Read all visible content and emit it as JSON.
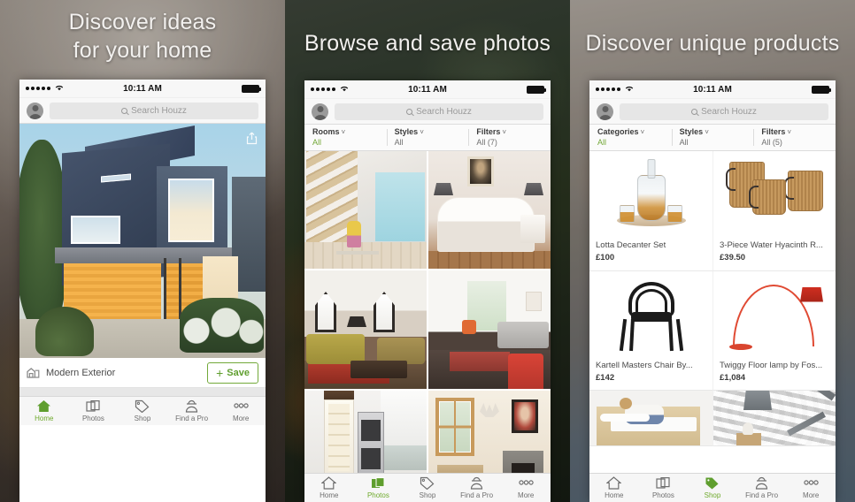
{
  "panels": [
    {
      "headline_line1": "Discover ideas",
      "headline_line2": "for your home",
      "status": {
        "time": "10:11 AM"
      },
      "search": {
        "placeholder": "Search Houzz"
      },
      "photo_caption": "Modern Exterior",
      "save_button": "Save",
      "save_plus": "+",
      "tabs": [
        {
          "label": "Home",
          "icon": "home-icon",
          "active": true
        },
        {
          "label": "Photos",
          "icon": "photos-icon",
          "active": false
        },
        {
          "label": "Shop",
          "icon": "tag-icon",
          "active": false
        },
        {
          "label": "Find a Pro",
          "icon": "pro-icon",
          "active": false
        },
        {
          "label": "More",
          "icon": "more-icon",
          "active": false
        }
      ]
    },
    {
      "headline_line1": "Browse and save photos",
      "headline_line2": "",
      "status": {
        "time": "10:11 AM"
      },
      "search": {
        "placeholder": "Search Houzz"
      },
      "filters": [
        {
          "title": "Rooms",
          "value": "All",
          "green": true
        },
        {
          "title": "Styles",
          "value": "All",
          "green": false
        },
        {
          "title": "Filters",
          "value": "All (7)",
          "green": false
        }
      ],
      "photos": [
        {
          "alt": "staircase playroom"
        },
        {
          "alt": "white bedroom with portrait"
        },
        {
          "alt": "olive sofa living room with red rug"
        },
        {
          "alt": "white modern living room with red chair"
        },
        {
          "alt": "white kitchen with open fridge"
        },
        {
          "alt": "hallway with fireplace and antlers"
        }
      ],
      "tabs": [
        {
          "label": "Home",
          "icon": "home-icon",
          "active": false
        },
        {
          "label": "Photos",
          "icon": "photos-icon",
          "active": true
        },
        {
          "label": "Shop",
          "icon": "tag-icon",
          "active": false
        },
        {
          "label": "Find a Pro",
          "icon": "pro-icon",
          "active": false
        },
        {
          "label": "More",
          "icon": "more-icon",
          "active": false
        }
      ]
    },
    {
      "headline_line1": "Discover unique products",
      "headline_line2": "",
      "status": {
        "time": "10:11 AM"
      },
      "search": {
        "placeholder": "Search Houzz"
      },
      "filters": [
        {
          "title": "Categories",
          "value": "All",
          "green": true
        },
        {
          "title": "Styles",
          "value": "All",
          "green": false
        },
        {
          "title": "Filters",
          "value": "All (5)",
          "green": false
        }
      ],
      "products": [
        {
          "name": "Lotta Decanter Set",
          "price": "£100"
        },
        {
          "name": "3-Piece Water Hyacinth R...",
          "price": "£39.50"
        },
        {
          "name": "Kartell Masters Chair By...",
          "price": "£142"
        },
        {
          "name": "Twiggy Floor lamp by Fos...",
          "price": "£1,084"
        }
      ],
      "tabs": [
        {
          "label": "Home",
          "icon": "home-icon",
          "active": false
        },
        {
          "label": "Photos",
          "icon": "photos-icon",
          "active": false
        },
        {
          "label": "Shop",
          "icon": "tag-icon",
          "active": true
        },
        {
          "label": "Find a Pro",
          "icon": "pro-icon",
          "active": false
        },
        {
          "label": "More",
          "icon": "more-icon",
          "active": false
        }
      ]
    }
  ],
  "colors": {
    "accent_green": "#6faa2c",
    "save_border": "#73a93a",
    "text_dark": "#3c3c3c",
    "text_muted": "#6f6f6f",
    "chrome_bg": "#f8f8f8"
  }
}
